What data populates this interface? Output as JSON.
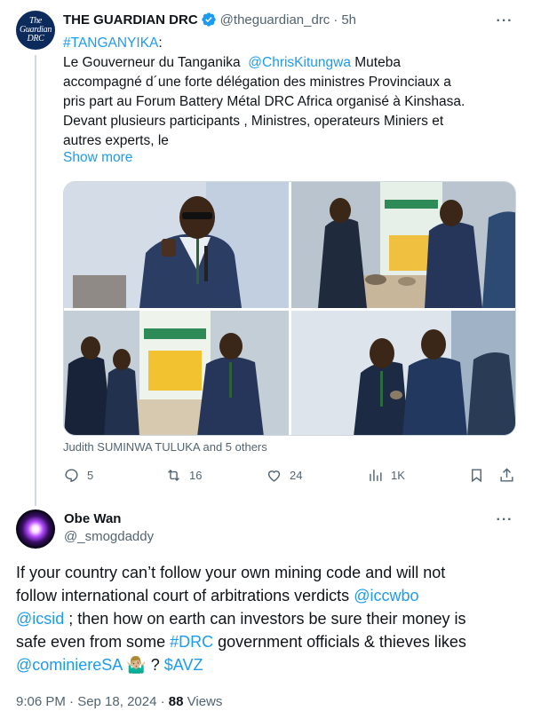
{
  "tweet1": {
    "author_name": "THE GUARDIAN DRC",
    "avatar_text": "The Guardian DRC",
    "handle": "@theguardian_drc",
    "separator": "·",
    "time": "5h",
    "text_lines": [
      {
        "hashtag": "#TANGANYIKA",
        "rest": ":"
      },
      {
        "pre": "Le Gouverneur du Tanganika  ",
        "mention": "@ChrisKitungwa",
        "post": " Muteba"
      },
      {
        "text": "accompagné d´une forte délégation des ministres Provinciaux a"
      },
      {
        "text": "pris part au Forum Battery Métal DRC Africa organisé à Kinshasa."
      },
      {
        "text": "Devant plusieurs participants , Ministres, operateurs Miniers et"
      },
      {
        "text": "autres experts, le"
      }
    ],
    "show_more": "Show more",
    "photos": [
      {
        "alt": "photo-speaker-at-podium"
      },
      {
        "alt": "photo-delegation-viewing-minerals"
      },
      {
        "alt": "photo-cominiere-stand"
      },
      {
        "alt": "photo-governor-holding-sample"
      }
    ],
    "tagged": "Judith SUMINWA TULUKA and 5 others",
    "stats": {
      "replies": "5",
      "reposts": "16",
      "likes": "24",
      "views": "1K"
    }
  },
  "tweet2": {
    "author_name": "Obe Wan",
    "handle": "@_smogdaddy",
    "text": {
      "line1": "If your country can’t follow your own mining code and will not",
      "line2_pre": "follow international court of arbitrations verdicts ",
      "mention1": "@iccwbo",
      "mention2": "@icsid",
      "line3_post": " ; then how on earth can investors be sure their money is",
      "line4_pre": "safe even from some ",
      "hashtag": "#DRC",
      "line4_post": " government officials & thieves likes",
      "mention3": "@cominiereSA",
      "emoji": " 🤷🏼‍♂️ ? ",
      "cashtag": "$AVZ"
    },
    "timestamp": "9:06 PM · Sep 18, 2024 · ",
    "views_count": "88",
    "views_label": " Views"
  },
  "colors": {
    "link": "#1d9bf0",
    "secondary_text": "#536471",
    "thread_line": "#cfd9de"
  }
}
